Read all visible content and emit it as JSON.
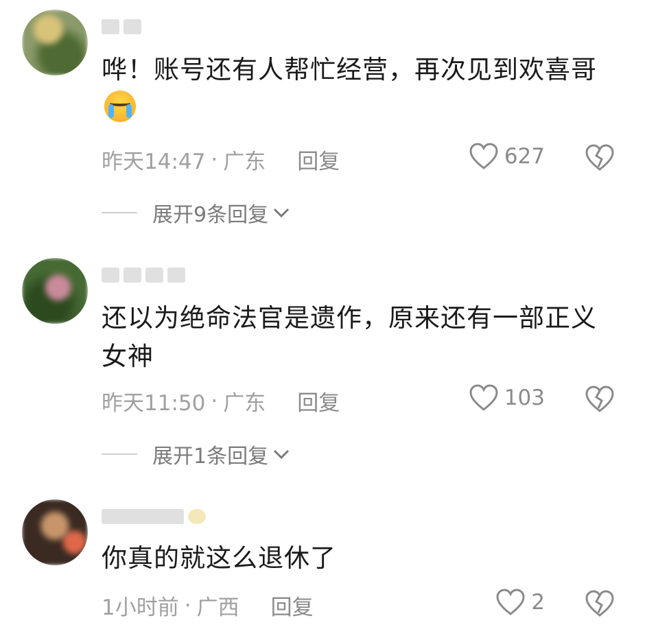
{
  "comments": [
    {
      "text": "哗！账号还有人帮忙经营，再次见到欢喜哥",
      "time": "昨天14:47",
      "location": "广东",
      "reply_label": "回复",
      "likes": "627",
      "expand_label": "展开9条回复",
      "avatar_colors": [
        "#7b8a5c",
        "#c9b98a",
        "#5d6b3e"
      ]
    },
    {
      "text": "还以为绝命法官是遗作，原来还有一部正义女神",
      "time": "昨天11:50",
      "location": "广东",
      "reply_label": "回复",
      "likes": "103",
      "expand_label": "展开1条回复",
      "avatar_colors": [
        "#3f5a2e",
        "#b07a88",
        "#1f2f16"
      ]
    },
    {
      "text": "你真的就这么退休了",
      "time": "1小时前",
      "location": "广西",
      "reply_label": "回复",
      "likes": "2",
      "avatar_colors": [
        "#3a2a22",
        "#c08a5a",
        "#e0684a"
      ]
    }
  ],
  "separator": "·",
  "icons": {
    "like": "heart-outline-icon",
    "dislike": "broken-heart-icon",
    "expand": "chevron-down-icon"
  }
}
